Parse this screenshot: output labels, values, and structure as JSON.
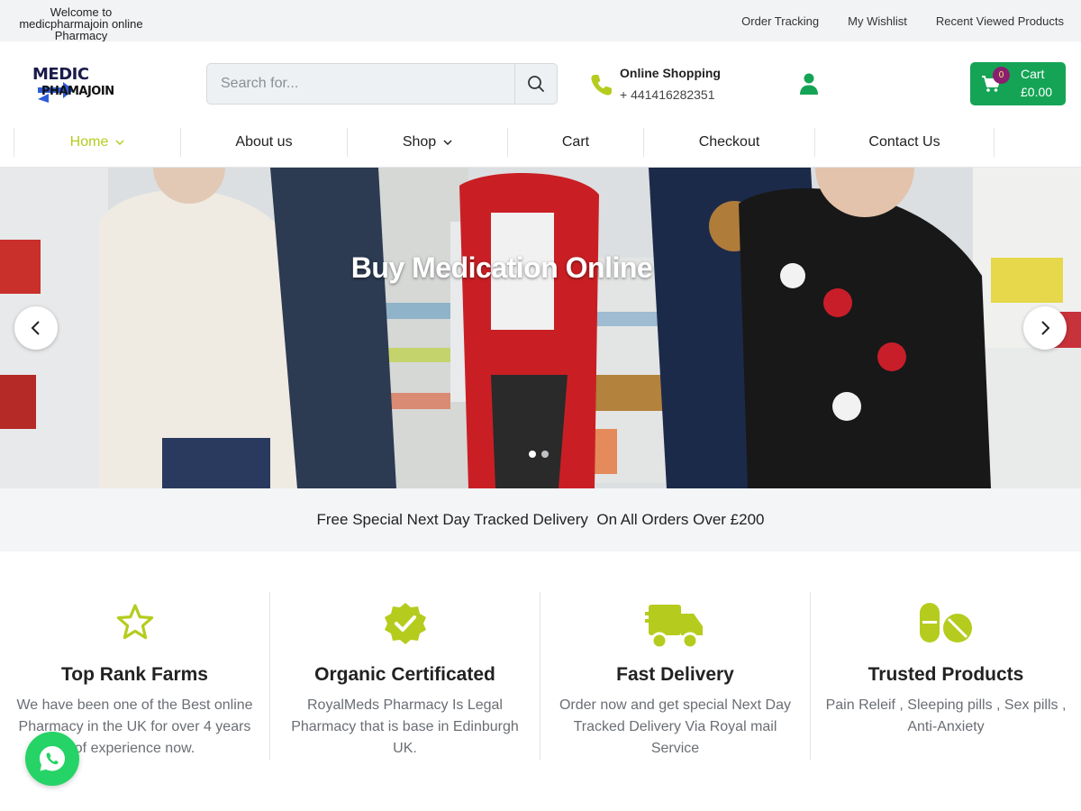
{
  "topbar": {
    "welcome": "Welcome to medicpharmajoin online Pharmacy",
    "links": [
      "Order Tracking",
      "My Wishlist",
      "Recent Viewed Products"
    ]
  },
  "header": {
    "logo": {
      "line1": "MEDIC",
      "line2": "PHAMAJOIN"
    },
    "search": {
      "placeholder": "Search for..."
    },
    "contact": {
      "title": "Online Shopping",
      "phone": "+ 441416282351"
    },
    "cart": {
      "label": "Cart",
      "amount": "£0.00",
      "count": "0"
    }
  },
  "nav": {
    "items": [
      {
        "label": "Home",
        "active": true,
        "dropdown": true
      },
      {
        "label": "About us"
      },
      {
        "label": "Shop",
        "dropdown": true
      },
      {
        "label": "Cart"
      },
      {
        "label": "Checkout"
      },
      {
        "label": "Contact Us"
      }
    ]
  },
  "hero": {
    "title": "Buy Medication Online",
    "slides": 2,
    "active_slide": 1
  },
  "promo": {
    "text": "Free Special Next Day Tracked Delivery  On All Orders Over £200"
  },
  "features": [
    {
      "icon": "star-icon",
      "title": "Top Rank Farms",
      "text": "We have been one of the Best online Pharmacy in the UK for over 4 years of experience now."
    },
    {
      "icon": "verified-badge-icon",
      "title": "Organic Certificated",
      "text": "RoyalMeds Pharmacy Is Legal Pharmacy that is base in Edinburgh UK."
    },
    {
      "icon": "delivery-truck-icon",
      "title": "Fast Delivery",
      "text": "Order now and get special Next Day Tracked Delivery Via Royal mail Service"
    },
    {
      "icon": "pills-icon",
      "title": "Trusted Products",
      "text": "Pain Releif , Sleeping pills , Sex pills , Anti-Anxiety"
    }
  ],
  "colors": {
    "accent": "#b5cc1e",
    "cart_green": "#15a455",
    "icon_green": "#b5cc1e",
    "whatsapp": "#25d366",
    "user_icon": "#15a455"
  }
}
